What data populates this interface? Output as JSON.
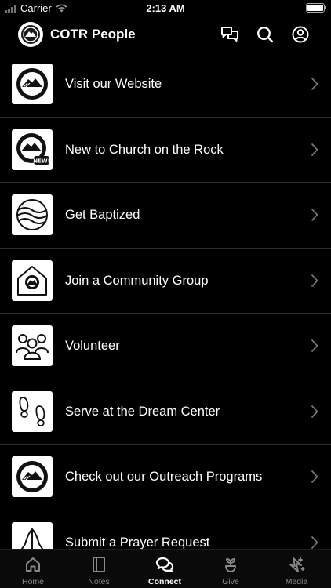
{
  "status_bar": {
    "carrier": "Carrier",
    "time": "2:13 AM"
  },
  "header": {
    "title": "COTR People",
    "icons": [
      "chat-icon",
      "search-icon",
      "profile-icon"
    ]
  },
  "items": [
    {
      "label": "Visit our Website",
      "icon": "mountain-logo-icon"
    },
    {
      "label": "New to Church on the Rock",
      "icon": "mountain-new-icon",
      "badge": "NEW!"
    },
    {
      "label": "Get Baptized",
      "icon": "water-waves-icon"
    },
    {
      "label": "Join a Community Group",
      "icon": "house-icon"
    },
    {
      "label": "Volunteer",
      "icon": "people-group-icon"
    },
    {
      "label": "Serve at the Dream Center",
      "icon": "footprints-icon"
    },
    {
      "label": "Check out our Outreach Programs",
      "icon": "mountain-logo-icon"
    },
    {
      "label": "Submit a Prayer Request",
      "icon": "praying-hands-icon"
    }
  ],
  "tabs": [
    {
      "label": "Home",
      "icon": "home-icon",
      "active": false
    },
    {
      "label": "Notes",
      "icon": "notes-icon",
      "active": false
    },
    {
      "label": "Connect",
      "icon": "connect-icon",
      "active": true
    },
    {
      "label": "Give",
      "icon": "give-icon",
      "active": false
    },
    {
      "label": "Media",
      "icon": "media-icon",
      "active": false
    }
  ],
  "colors": {
    "background": "#000000",
    "text": "#ffffff",
    "inactive": "#8a8a8a",
    "divider": "#2b2b2b"
  }
}
